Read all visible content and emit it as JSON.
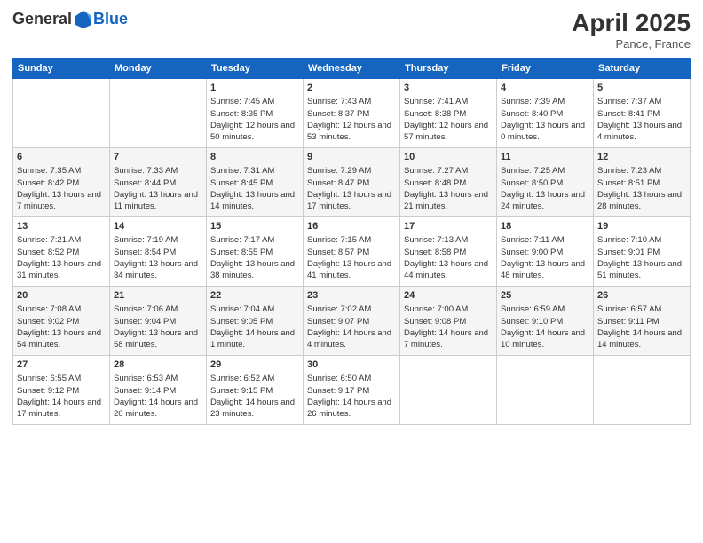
{
  "logo": {
    "general": "General",
    "blue": "Blue"
  },
  "title": "April 2025",
  "subtitle": "Pance, France",
  "days_header": [
    "Sunday",
    "Monday",
    "Tuesday",
    "Wednesday",
    "Thursday",
    "Friday",
    "Saturday"
  ],
  "weeks": [
    [
      {
        "day": "",
        "info": ""
      },
      {
        "day": "",
        "info": ""
      },
      {
        "day": "1",
        "info": "Sunrise: 7:45 AM\nSunset: 8:35 PM\nDaylight: 12 hours and 50 minutes."
      },
      {
        "day": "2",
        "info": "Sunrise: 7:43 AM\nSunset: 8:37 PM\nDaylight: 12 hours and 53 minutes."
      },
      {
        "day": "3",
        "info": "Sunrise: 7:41 AM\nSunset: 8:38 PM\nDaylight: 12 hours and 57 minutes."
      },
      {
        "day": "4",
        "info": "Sunrise: 7:39 AM\nSunset: 8:40 PM\nDaylight: 13 hours and 0 minutes."
      },
      {
        "day": "5",
        "info": "Sunrise: 7:37 AM\nSunset: 8:41 PM\nDaylight: 13 hours and 4 minutes."
      }
    ],
    [
      {
        "day": "6",
        "info": "Sunrise: 7:35 AM\nSunset: 8:42 PM\nDaylight: 13 hours and 7 minutes."
      },
      {
        "day": "7",
        "info": "Sunrise: 7:33 AM\nSunset: 8:44 PM\nDaylight: 13 hours and 11 minutes."
      },
      {
        "day": "8",
        "info": "Sunrise: 7:31 AM\nSunset: 8:45 PM\nDaylight: 13 hours and 14 minutes."
      },
      {
        "day": "9",
        "info": "Sunrise: 7:29 AM\nSunset: 8:47 PM\nDaylight: 13 hours and 17 minutes."
      },
      {
        "day": "10",
        "info": "Sunrise: 7:27 AM\nSunset: 8:48 PM\nDaylight: 13 hours and 21 minutes."
      },
      {
        "day": "11",
        "info": "Sunrise: 7:25 AM\nSunset: 8:50 PM\nDaylight: 13 hours and 24 minutes."
      },
      {
        "day": "12",
        "info": "Sunrise: 7:23 AM\nSunset: 8:51 PM\nDaylight: 13 hours and 28 minutes."
      }
    ],
    [
      {
        "day": "13",
        "info": "Sunrise: 7:21 AM\nSunset: 8:52 PM\nDaylight: 13 hours and 31 minutes."
      },
      {
        "day": "14",
        "info": "Sunrise: 7:19 AM\nSunset: 8:54 PM\nDaylight: 13 hours and 34 minutes."
      },
      {
        "day": "15",
        "info": "Sunrise: 7:17 AM\nSunset: 8:55 PM\nDaylight: 13 hours and 38 minutes."
      },
      {
        "day": "16",
        "info": "Sunrise: 7:15 AM\nSunset: 8:57 PM\nDaylight: 13 hours and 41 minutes."
      },
      {
        "day": "17",
        "info": "Sunrise: 7:13 AM\nSunset: 8:58 PM\nDaylight: 13 hours and 44 minutes."
      },
      {
        "day": "18",
        "info": "Sunrise: 7:11 AM\nSunset: 9:00 PM\nDaylight: 13 hours and 48 minutes."
      },
      {
        "day": "19",
        "info": "Sunrise: 7:10 AM\nSunset: 9:01 PM\nDaylight: 13 hours and 51 minutes."
      }
    ],
    [
      {
        "day": "20",
        "info": "Sunrise: 7:08 AM\nSunset: 9:02 PM\nDaylight: 13 hours and 54 minutes."
      },
      {
        "day": "21",
        "info": "Sunrise: 7:06 AM\nSunset: 9:04 PM\nDaylight: 13 hours and 58 minutes."
      },
      {
        "day": "22",
        "info": "Sunrise: 7:04 AM\nSunset: 9:05 PM\nDaylight: 14 hours and 1 minute."
      },
      {
        "day": "23",
        "info": "Sunrise: 7:02 AM\nSunset: 9:07 PM\nDaylight: 14 hours and 4 minutes."
      },
      {
        "day": "24",
        "info": "Sunrise: 7:00 AM\nSunset: 9:08 PM\nDaylight: 14 hours and 7 minutes."
      },
      {
        "day": "25",
        "info": "Sunrise: 6:59 AM\nSunset: 9:10 PM\nDaylight: 14 hours and 10 minutes."
      },
      {
        "day": "26",
        "info": "Sunrise: 6:57 AM\nSunset: 9:11 PM\nDaylight: 14 hours and 14 minutes."
      }
    ],
    [
      {
        "day": "27",
        "info": "Sunrise: 6:55 AM\nSunset: 9:12 PM\nDaylight: 14 hours and 17 minutes."
      },
      {
        "day": "28",
        "info": "Sunrise: 6:53 AM\nSunset: 9:14 PM\nDaylight: 14 hours and 20 minutes."
      },
      {
        "day": "29",
        "info": "Sunrise: 6:52 AM\nSunset: 9:15 PM\nDaylight: 14 hours and 23 minutes."
      },
      {
        "day": "30",
        "info": "Sunrise: 6:50 AM\nSunset: 9:17 PM\nDaylight: 14 hours and 26 minutes."
      },
      {
        "day": "",
        "info": ""
      },
      {
        "day": "",
        "info": ""
      },
      {
        "day": "",
        "info": ""
      }
    ]
  ]
}
